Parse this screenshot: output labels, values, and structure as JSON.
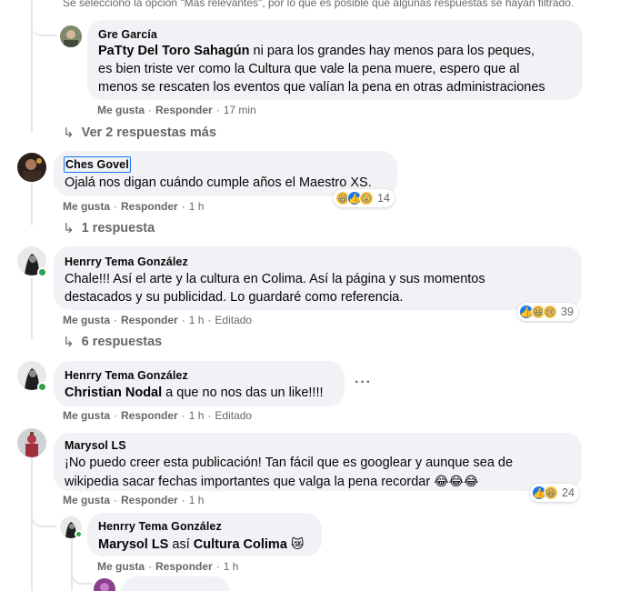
{
  "filter_notice": "Se seleccionó la opción \"Más relevantes\", por lo que es posible que algunas respuestas se hayan filtrado.",
  "actions": {
    "like": "Me gusta",
    "reply": "Responder",
    "edited": "Editado"
  },
  "comments": [
    {
      "author": "Gre García",
      "mention": "PaTty Del Toro Sahagún",
      "text_lines": [
        " ni para los grandes hay menos para los peques,",
        "es bien triste ver como la Cultura que vale la pena muere, espero que al",
        "menos se rescaten los eventos que valían la pena en otras administraciones"
      ],
      "time": "17 min",
      "replies_link": "Ver 2 respuestas más"
    },
    {
      "author": "Ches Govel",
      "text": "Ojalá nos digan cuándo cumple años el Maestro XS.",
      "time": "1 h",
      "reaction_count": "14",
      "replies_link": "1 respuesta"
    },
    {
      "author": "Henrry Tema González",
      "text_lines": [
        "Chale!!! Así el arte y la cultura en Colima. Así la página y sus momentos",
        "destacados y su publicidad. Lo guardaré como referencia."
      ],
      "time": "1 h",
      "reaction_count": "39",
      "replies_link": "6 respuestas"
    },
    {
      "author": "Henrry Tema González",
      "mention": "Christian Nodal",
      "text": " a que no nos das un like!!!!",
      "time": "1 h"
    },
    {
      "author": "Marysol LS",
      "text_lines": [
        "¡No puedo creer esta publicación! Tan fácil que es googlear y aunque sea de",
        "wikipedia sacar fechas importantes que valga la pena recordar "
      ],
      "trailing_emoji": "😂😂😂",
      "time": "1 h",
      "reaction_count": "24"
    },
    {
      "author": "Henrry Tema González",
      "mention": "Marysol LS",
      "text": " así ",
      "bold_tail": "Cultura Colima",
      "trailing_emoji": "😿",
      "time": "1 h"
    }
  ]
}
